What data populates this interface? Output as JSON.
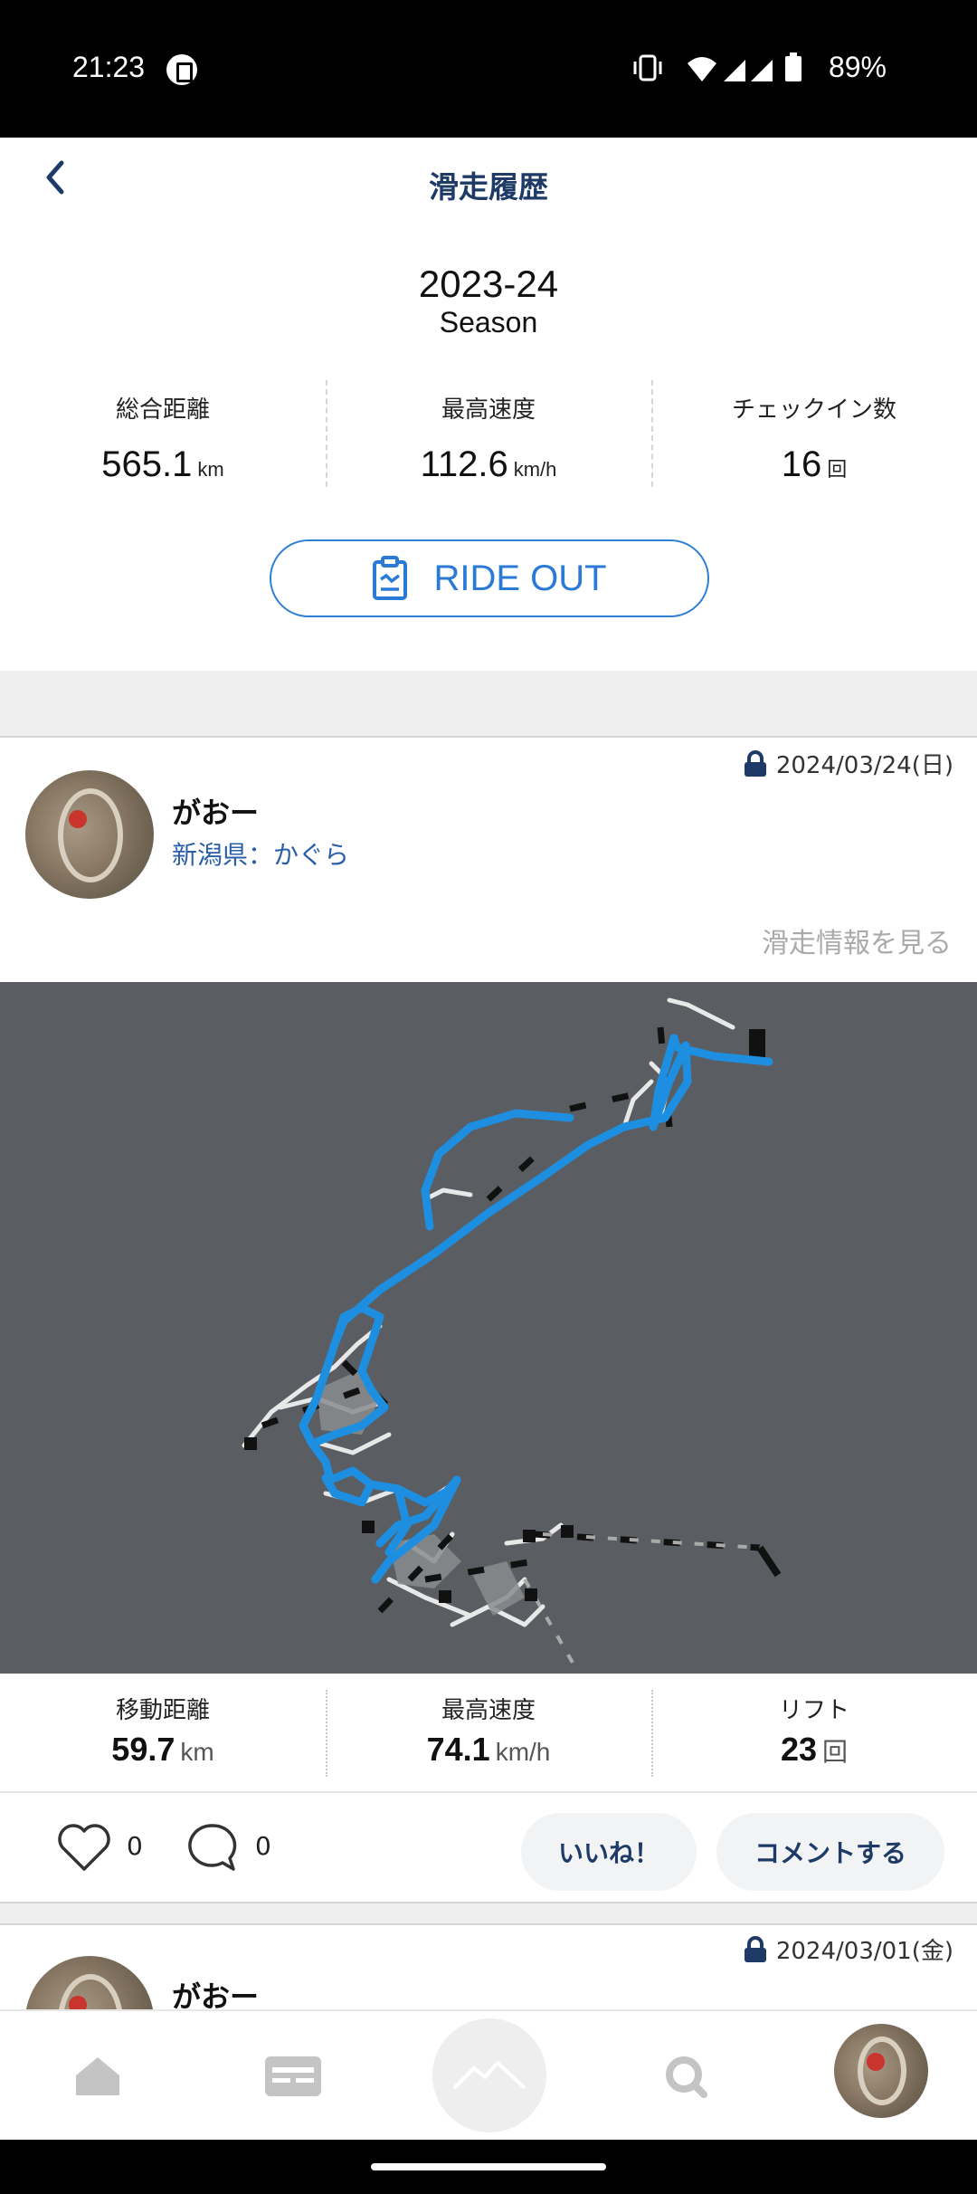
{
  "status_bar": {
    "time": "21:23",
    "battery": "89%"
  },
  "header": {
    "title": "滑走履歴"
  },
  "season": {
    "year": "2023-24",
    "label": "Season"
  },
  "summary_stats": [
    {
      "label": "総合距離",
      "value": "565.1",
      "unit": "km"
    },
    {
      "label": "最高速度",
      "value": "112.6",
      "unit": "km/h"
    },
    {
      "label": "チェックイン数",
      "value": "16",
      "unit": "回"
    }
  ],
  "ride_out": {
    "label": "RIDE OUT"
  },
  "posts": [
    {
      "date": "2024/03/24(日)",
      "user": "がおー",
      "location": "新潟県：かぐら",
      "view_info": "滑走情報を見る",
      "stats": [
        {
          "label": "移動距離",
          "value": "59.7",
          "unit": "km"
        },
        {
          "label": "最高速度",
          "value": "74.1",
          "unit": "km/h"
        },
        {
          "label": "リフト",
          "value": "23",
          "unit": "回"
        }
      ],
      "likes": "0",
      "comments": "0",
      "like_button": "いいね！",
      "comment_button": "コメントする"
    },
    {
      "date": "2024/03/01(金)",
      "user": "がおー"
    }
  ],
  "colors": {
    "accent": "#2a7ad6",
    "title": "#1e3a66",
    "track": "#1e8fe0",
    "map_bg": "#5a5d61"
  },
  "icons": {
    "back": "chevron-left-icon",
    "ride_out": "clipboard-icon",
    "lock": "lock-icon",
    "like": "heart-icon",
    "comment": "speech-bubble-icon",
    "nav": [
      "home-icon",
      "card-icon",
      "mountain-icon",
      "search-icon",
      "profile-avatar"
    ]
  }
}
